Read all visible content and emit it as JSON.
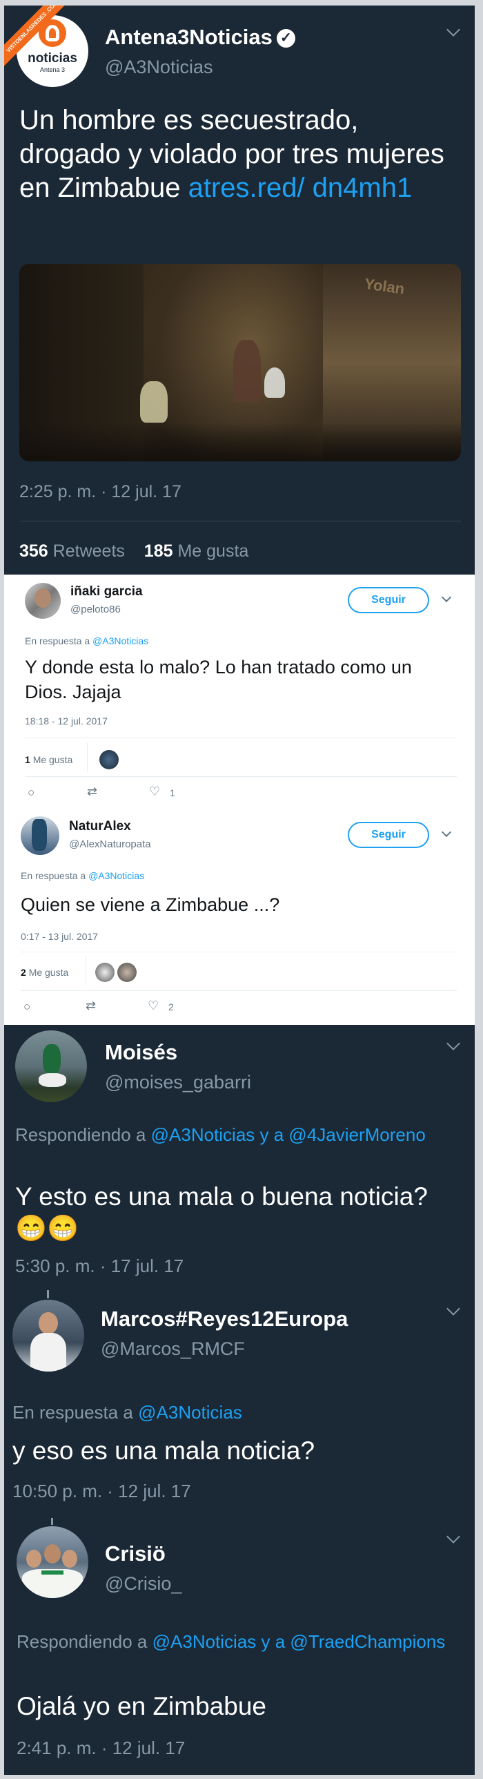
{
  "watermark": "VISTOENLASREDES .COM",
  "tweet1": {
    "avatar_label": "noticias",
    "avatar_sublabel": "Antena 3",
    "name": "Antena3Noticias",
    "handle": "@A3Noticias",
    "text": "Un hombre es secuestrado, drogado y violado por tres mujeres en Zimbabue",
    "link": "atres.red/ dn4mh1",
    "media_sign": "Yolan",
    "time": "2:25 p. m. · 12 jul. 17",
    "retweets_count": "356",
    "retweets_label": "Retweets",
    "likes_count": "185",
    "likes_label": "Me gusta"
  },
  "reply1": {
    "name": "iñaki garcia",
    "handle": "@peloto86",
    "follow_label": "Seguir",
    "reply_prefix": "En respuesta a",
    "reply_to": "@A3Noticias",
    "text": "Y donde esta lo malo? Lo han tratado como un Dios. Jajaja",
    "time": "18:18 - 12 jul. 2017",
    "likes_count": "1",
    "likes_label": "Me gusta",
    "like_action_count": "1"
  },
  "reply2": {
    "name": "NaturAlex",
    "handle": "@AlexNaturopata",
    "follow_label": "Seguir",
    "reply_prefix": "En respuesta a",
    "reply_to": "@A3Noticias",
    "text": "Quien se viene a Zimbabue ...?",
    "time": "0:17 - 13 jul. 2017",
    "likes_count": "2",
    "likes_label": "Me gusta",
    "like_action_count": "2"
  },
  "reply3": {
    "name": "Moisés",
    "handle": "@moises_gabarri",
    "reply_prefix": "Respondiendo a",
    "reply_to": "@A3Noticias y a @4JavierMoreno",
    "text": "Y esto es una mala o buena noticia? 😁😁",
    "time": "5:30 p. m. · 17 jul. 17"
  },
  "reply4": {
    "name": "Marcos#Reyes12Europa",
    "handle": "@Marcos_RMCF",
    "reply_prefix": "En respuesta a",
    "reply_to": "@A3Noticias",
    "text": "y eso es una mala noticia?",
    "time": "10:50 p. m. · 12 jul. 17"
  },
  "reply5": {
    "name": "Crisiö",
    "handle": "@Crisio_",
    "reply_prefix": "Respondiendo a",
    "reply_to": "@A3Noticias y a @TraedChampions",
    "text": "Ojalá yo en Zimbabue",
    "time": "2:41 p. m. · 12 jul. 17"
  },
  "colors": {
    "background_dark": "#1b2836",
    "accent": "#1da1f2",
    "muted": "#8899a6",
    "brand_orange": "#f26a1b"
  }
}
